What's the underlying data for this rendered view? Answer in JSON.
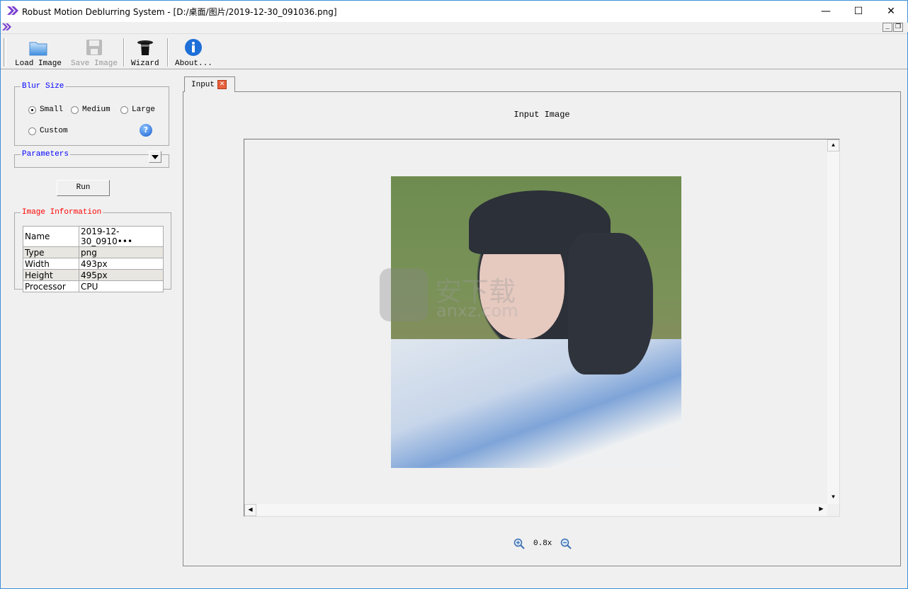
{
  "window": {
    "title": "Robust Motion Deblurring System - [D:/桌面/图片/2019-12-30_091036.png]",
    "minimize": "—",
    "maximize": "☐",
    "close": "✕"
  },
  "mdi": {
    "minimize": "_",
    "restore": "❐",
    "close": "✕"
  },
  "toolbar": {
    "load": "Load Image",
    "save": "Save Image",
    "wizard": "Wizard",
    "about": "About..."
  },
  "blur_size": {
    "legend": "Blur Size",
    "options": [
      {
        "label": "Small",
        "selected": true
      },
      {
        "label": "Medium",
        "selected": false
      },
      {
        "label": "Large",
        "selected": false
      },
      {
        "label": "Custom",
        "selected": false
      }
    ],
    "help": "?"
  },
  "parameters": {
    "legend": "Parameters"
  },
  "run_label": "Run",
  "image_info": {
    "legend": "Image Information",
    "rows": [
      [
        "Name",
        "2019-12-30_0910•••"
      ],
      [
        "Type",
        "png"
      ],
      [
        "Width",
        "493px"
      ],
      [
        "Height",
        "495px"
      ],
      [
        "Processor",
        "CPU"
      ]
    ]
  },
  "tabs": [
    {
      "label": "Input",
      "close": "✕"
    }
  ],
  "viewer": {
    "title": "Input Image",
    "zoom": "0.8x"
  },
  "watermark": "安下载 anxz.com",
  "colors": {
    "legend_blue": "#0000ff",
    "legend_red": "#ff0000",
    "annotation_arrow": "#e02020"
  }
}
